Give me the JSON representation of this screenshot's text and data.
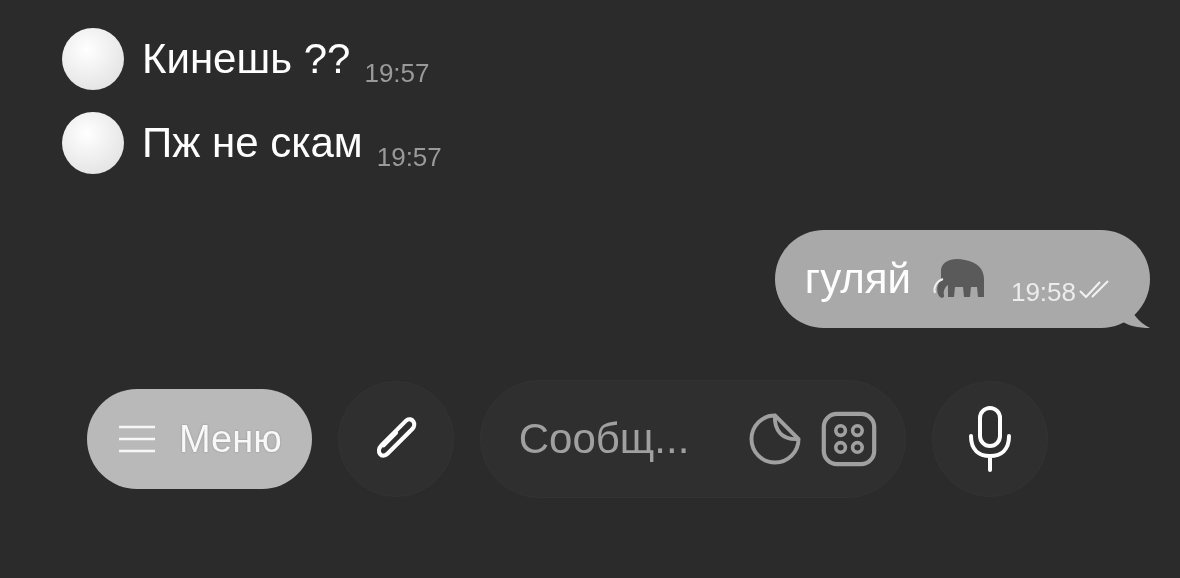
{
  "messages": [
    {
      "kind": "incoming",
      "text": "Кинешь ??",
      "time": "19:57"
    },
    {
      "kind": "incoming",
      "text": "Пж не скам",
      "time": "19:57"
    },
    {
      "kind": "outgoing",
      "text": "гуляй",
      "time": "19:58",
      "read": true
    }
  ],
  "composer": {
    "menu_button": "Меню",
    "placeholder": "Сообщ..."
  }
}
